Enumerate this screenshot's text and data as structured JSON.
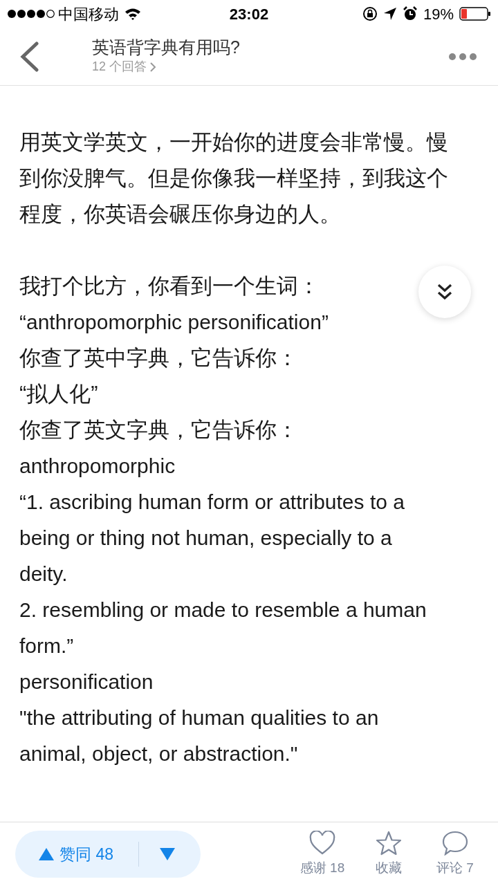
{
  "status_bar": {
    "carrier": "中国移动",
    "time": "23:02",
    "battery": "19%"
  },
  "header": {
    "title": "英语背字典有用吗?",
    "subtitle": "12 个回答"
  },
  "content": [
    {
      "lines": [
        "用英文学英文，一开始你的进度会非常慢。慢",
        "到你没脾气。但是你像我一样坚持，到我这个",
        "程度，你英语会碾压你身边的人。"
      ]
    },
    {
      "lines": [
        "我打个比方，你看到一个生词：",
        "“anthropomorphic personification”",
        "你查了英中字典，它告诉你：",
        "“拟人化”",
        "你查了英文字典，它告诉你：",
        "anthropomorphic",
        "“1. ascribing human form or attributes to a",
        "being or thing not human, especially to a",
        "deity.",
        "2. resembling or made to resemble a human",
        "form.”",
        "personification",
        "\"the attributing of human qualities to an",
        "animal, object, or abstraction.\""
      ]
    }
  ],
  "bottom_bar": {
    "vote": {
      "label": "赞同 48"
    },
    "actions": [
      {
        "kind": "heart",
        "label": "感谢 18"
      },
      {
        "kind": "star",
        "label": "收藏"
      },
      {
        "kind": "comment",
        "label": "评论 7"
      }
    ]
  }
}
